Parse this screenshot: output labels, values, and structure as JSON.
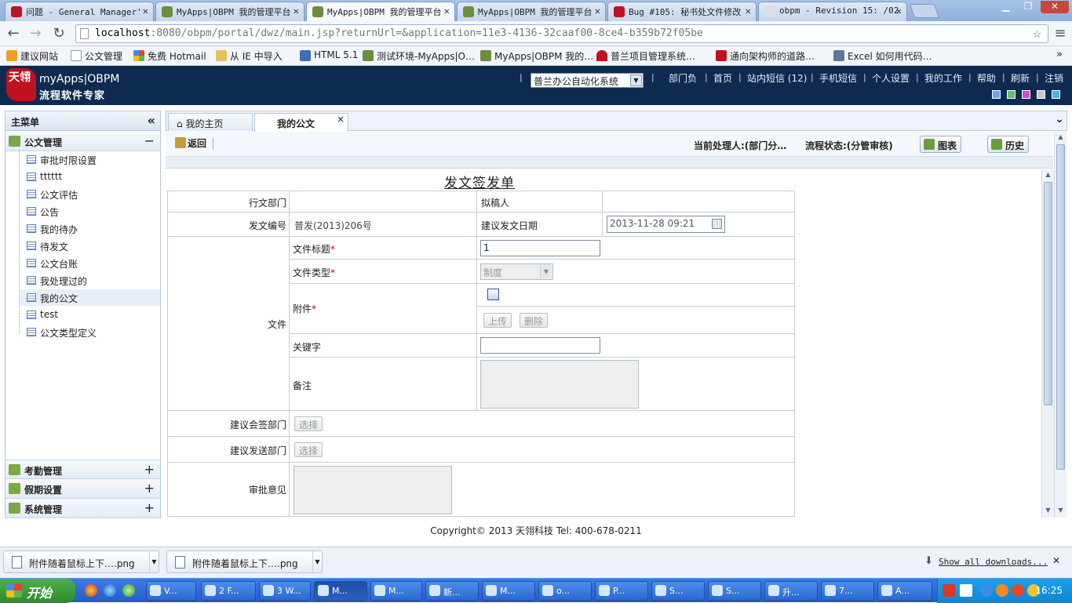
{
  "browser": {
    "tabs": [
      {
        "title": "问题 - General Manager'",
        "color": "#c0121e"
      },
      {
        "title": "MyApps|OBPM 我的管理平台",
        "color": "#6b8e3a"
      },
      {
        "title": "MyApps|OBPM 我的管理平台",
        "color": "#6b8e3a"
      },
      {
        "title": "MyApps|OBPM 我的管理平台",
        "color": "#6b8e3a"
      },
      {
        "title": "Bug #105: 秘书处文件修改",
        "color": "#c0121e"
      },
      {
        "title": "obpm - Revision 15: /02",
        "color": "#7a8aa0"
      }
    ],
    "close_glyph": "✕",
    "window_controls": [
      "▁",
      "❐",
      "✕"
    ],
    "url_host": "localhost",
    "url_rest": ":8080/obpm/portal/dwz/main.jsp?returnUrl=&application=11e3-4136-32caaf00-8ce4-b359b72f05be",
    "nav": {
      "back": "←",
      "forward": "→",
      "reload": "↻",
      "star": "☆",
      "menu": "≡"
    },
    "bookmarks": [
      {
        "label": "建议网站",
        "color": "#f0a020"
      },
      {
        "label": "公文管理",
        "color": "#e0e4ea"
      },
      {
        "label": "免费 Hotmail",
        "color": "#3a78d0"
      },
      {
        "label": "从 IE 中导入",
        "color": "#e8c060"
      },
      {
        "label": "HTML 5.1",
        "color": "#3b6fb0"
      },
      {
        "label": "测试环境-MyApps|O…",
        "color": "#6b8e3a"
      },
      {
        "label": "MyApps|OBPM 我的…",
        "color": "#6b8e3a"
      },
      {
        "label": "普兰项目管理系统…",
        "color": "#c0121e"
      },
      {
        "label": "通向架构师的道路…",
        "color": "#c0121e"
      },
      {
        "label": "Excel 如何用代码…",
        "color": "#5a7a9a"
      }
    ],
    "bookmarks_more": "»"
  },
  "header": {
    "logo_mark": "天翎",
    "logo_line1": "myApps|OBPM",
    "logo_line2": "流程软件专家",
    "system_select": "普兰办公自动化系统",
    "select_arrow": "▼",
    "links": [
      "部门负",
      "首页",
      "站内短信 (12)",
      "手机短信",
      "个人设置",
      "我的工作",
      "帮助",
      "刷新",
      "注销"
    ],
    "link_sep": "|",
    "swatches": [
      "#6aa7e8",
      "#59c26a",
      "#d04bc8",
      "#c8c8c8",
      "#4ab0e8"
    ]
  },
  "menu": {
    "title": "主菜单",
    "collapse_glyph": "«",
    "sections": [
      {
        "label": "公文管理",
        "toggle": "−"
      },
      {
        "label": "考勤管理",
        "toggle": "+"
      },
      {
        "label": "假期设置",
        "toggle": "+"
      },
      {
        "label": "系统管理",
        "toggle": "+"
      }
    ],
    "items": [
      "审批时限设置",
      "tttttt",
      "公文评估",
      "公告",
      "我的待办",
      "待发文",
      "公文台账",
      "我处理过的",
      "我的公文",
      "test",
      "公文类型定义"
    ]
  },
  "pagetabs": [
    {
      "label": "我的主页",
      "icon": "⌂"
    },
    {
      "label": "我的公文",
      "close": "×"
    }
  ],
  "tab_overflow": "⌄",
  "toolbar": {
    "back": "返回",
    "current_handler": "当前处理人:(部门分…",
    "flow_status": "流程状态:(分管审核)",
    "chart": "图表",
    "history": "历史"
  },
  "form": {
    "title": "发文签发单",
    "dept_label": "行文部门",
    "drafter_label": "拟稿人",
    "number_label": "发文编号",
    "number_value": "普发(2013)206号",
    "date_label": "建议发文日期",
    "date_value": "2013-11-28 09:21",
    "group_label": "文件",
    "file_title_label": "文件标题",
    "file_title_value": "1",
    "file_type_label": "文件类型",
    "file_type_value": "制度",
    "attach_label": "附件",
    "upload": "上传",
    "delete": "删除",
    "keyword_label": "关键字",
    "remark_label": "备注",
    "cosign_label": "建议会签部门",
    "send_label": "建议发送部门",
    "choose": "选择",
    "opinion_label": "审批意见",
    "required": "*"
  },
  "footer": "Copyright© 2013 天翎科技 Tel: 400-678-0211",
  "downloads": {
    "items": [
      "附件随着鼠标上下….png",
      "附件随着鼠标上下….png"
    ],
    "show_all": "Show all downloads...",
    "close": "✕"
  },
  "taskbar": {
    "start": "开始",
    "tasks": [
      "V...",
      "2 F...",
      "3 W...",
      "M...",
      "M...",
      "新...",
      "M...",
      "o...",
      "P...",
      "S...",
      "S...",
      "升...",
      "7...",
      "A..."
    ],
    "clock": "16:25"
  }
}
